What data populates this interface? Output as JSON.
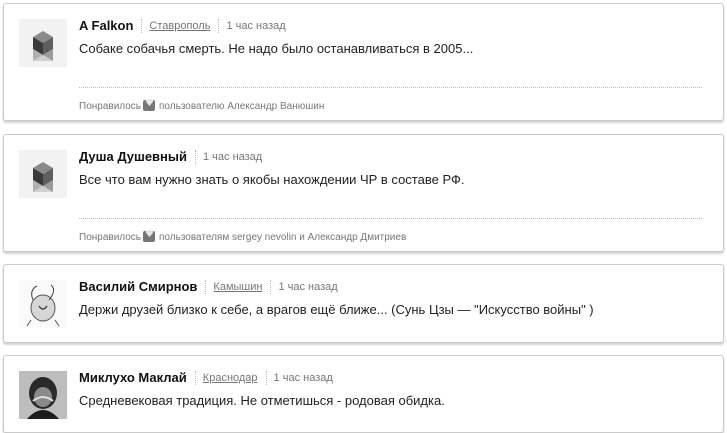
{
  "comments": [
    {
      "author": "A Falkon",
      "city": "Ставрополь",
      "time": "1 час назад",
      "text": "Собаке собачья смерть. Не надо было останавливаться в 2005...",
      "likes_label": "Понравилось",
      "likes_users": "пользователю Александр Ванюшин",
      "avatar_icon": "geometric-avatar-icon"
    },
    {
      "author": "Душа Душевный",
      "city": "",
      "time": "1 час назад",
      "text": "Все что вам нужно знать о якобы нахождении ЧР в составе РФ.",
      "likes_label": "Понравилось",
      "likes_users": "пользователям sergey nevolin и Александр Дмитриев",
      "avatar_icon": "geometric-avatar-icon"
    },
    {
      "author": "Василий Смирнов",
      "city": "Камышин",
      "time": "1 час назад",
      "text": "Держи друзей близко к себе, а врагов ещё ближе... (Сунь Цзы — \"Искусство войны\" )",
      "avatar_icon": "sketch-avatar-icon"
    },
    {
      "author": "Миклухо Маклай",
      "city": "Краснодар",
      "time": "1 час назад",
      "text": "Средневековая традиция. Не отметишься - родовая обидка.",
      "avatar_icon": "photo-avatar-icon"
    }
  ],
  "colors": {
    "border": "#c9c9c9",
    "muted": "#777777",
    "heart": "#777777"
  }
}
